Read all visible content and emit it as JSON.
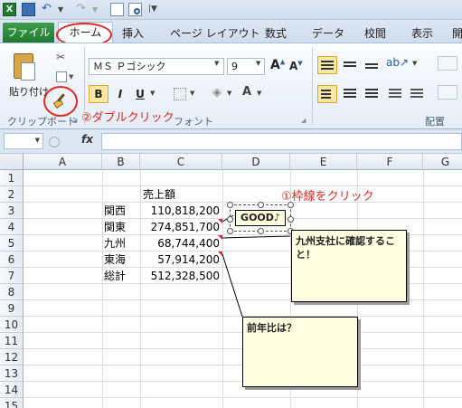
{
  "ribbon_tabs": {
    "file": "ファイル",
    "home": "ホーム",
    "insert": "挿入",
    "page_layout": "ページ レイアウト",
    "formulas": "数式",
    "data": "データ",
    "review": "校閲",
    "view": "表示",
    "developer": "開"
  },
  "clipboard": {
    "paste_label": "貼り付け",
    "group_label": "クリップボード"
  },
  "font": {
    "name": "ＭＳ Ｐゴシック",
    "size": "9",
    "bold": "B",
    "italic": "I",
    "underline": "U",
    "group_label": "フォント",
    "grow_label": "A",
    "shrink_label": "A"
  },
  "alignment": {
    "group_label": "配置"
  },
  "annotations": {
    "double_click": "②ダブルクリック",
    "click_border": "①枠線をクリック"
  },
  "formula_bar": {
    "fx": "fx",
    "content": ""
  },
  "columns": [
    "A",
    "B",
    "C",
    "D",
    "E",
    "F",
    "G"
  ],
  "rows": [
    "1",
    "2",
    "3",
    "4",
    "5",
    "6",
    "7",
    "8",
    "9",
    "10",
    "11",
    "12",
    "13",
    "14",
    "15"
  ],
  "sheet": {
    "header": "売上額",
    "regions": [
      "関西",
      "関東",
      "九州",
      "東海",
      "総計"
    ],
    "values": [
      "110,818,200",
      "274,851,700",
      "68,744,400",
      "57,914,200",
      "512,328,500"
    ]
  },
  "shapes": {
    "good_label": "GOOD♪",
    "comment_kyushu": "九州支社に確認すること！",
    "comment_prev_year": "前年比は？"
  },
  "colors": {
    "file_tab": "#2a8a3b",
    "annotation_red": "#e0281e",
    "comment_bg": "#ffffe1",
    "highlight": "#fff3a6"
  }
}
